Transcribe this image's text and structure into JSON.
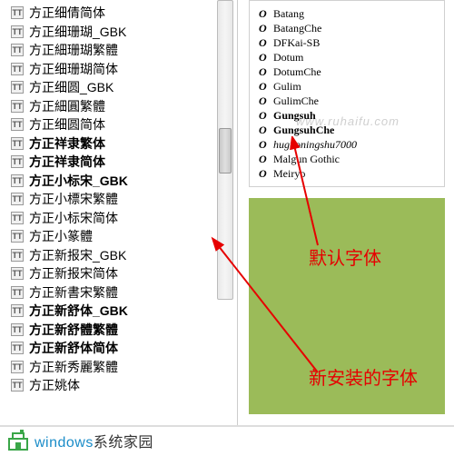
{
  "left_fonts": [
    {
      "name": "方正细倩简体",
      "bold": false
    },
    {
      "name": "方正细珊瑚_GBK",
      "bold": false
    },
    {
      "name": "方正細珊瑚繁體",
      "bold": false
    },
    {
      "name": "方正细珊瑚简体",
      "bold": false
    },
    {
      "name": "方正细圆_GBK",
      "bold": false
    },
    {
      "name": "方正細圓繁體",
      "bold": false
    },
    {
      "name": "方正细圆简体",
      "bold": false
    },
    {
      "name": "方正祥隶繁体",
      "bold": true
    },
    {
      "name": "方正祥隶简体",
      "bold": true
    },
    {
      "name": "方正小标宋_GBK",
      "bold": true
    },
    {
      "name": "方正小標宋繁體",
      "bold": false
    },
    {
      "name": "方正小标宋简体",
      "bold": false
    },
    {
      "name": "方正小篆體",
      "bold": false
    },
    {
      "name": "方正新报宋_GBK",
      "bold": false
    },
    {
      "name": "方正新报宋简体",
      "bold": false
    },
    {
      "name": "方正新書宋繁體",
      "bold": false
    },
    {
      "name": "方正新舒体_GBK",
      "bold": true
    },
    {
      "name": "方正新舒體繁體",
      "bold": true
    },
    {
      "name": "方正新舒体简体",
      "bold": true
    },
    {
      "name": "方正新秀麗繁體",
      "bold": false
    },
    {
      "name": "方正姚体",
      "bold": false
    }
  ],
  "right_fonts": [
    {
      "name": "Batang",
      "bold": false,
      "italic": false
    },
    {
      "name": "BatangChe",
      "bold": false,
      "italic": false
    },
    {
      "name": "DFKai-SB",
      "bold": false,
      "italic": false
    },
    {
      "name": "Dotum",
      "bold": false,
      "italic": false
    },
    {
      "name": "DotumChe",
      "bold": false,
      "italic": false
    },
    {
      "name": "Gulim",
      "bold": false,
      "italic": false
    },
    {
      "name": "GulimChe",
      "bold": false,
      "italic": false
    },
    {
      "name": "Gungsuh",
      "bold": true,
      "italic": false
    },
    {
      "name": "GungsuhChe",
      "bold": true,
      "italic": false
    },
    {
      "name": "huguoningshu7000",
      "bold": false,
      "italic": true
    },
    {
      "name": "Malgun Gothic",
      "bold": false,
      "italic": false
    },
    {
      "name": "Meiryo",
      "bold": false,
      "italic": false
    }
  ],
  "annotations": {
    "default_font": "默认字体",
    "new_font": "新安装的字体"
  },
  "watermark": "www.ruhaifu.com",
  "footer": {
    "brand_win": "windows",
    "brand_rest": "系统家园"
  },
  "icons": {
    "tt": "T",
    "o": "O"
  }
}
